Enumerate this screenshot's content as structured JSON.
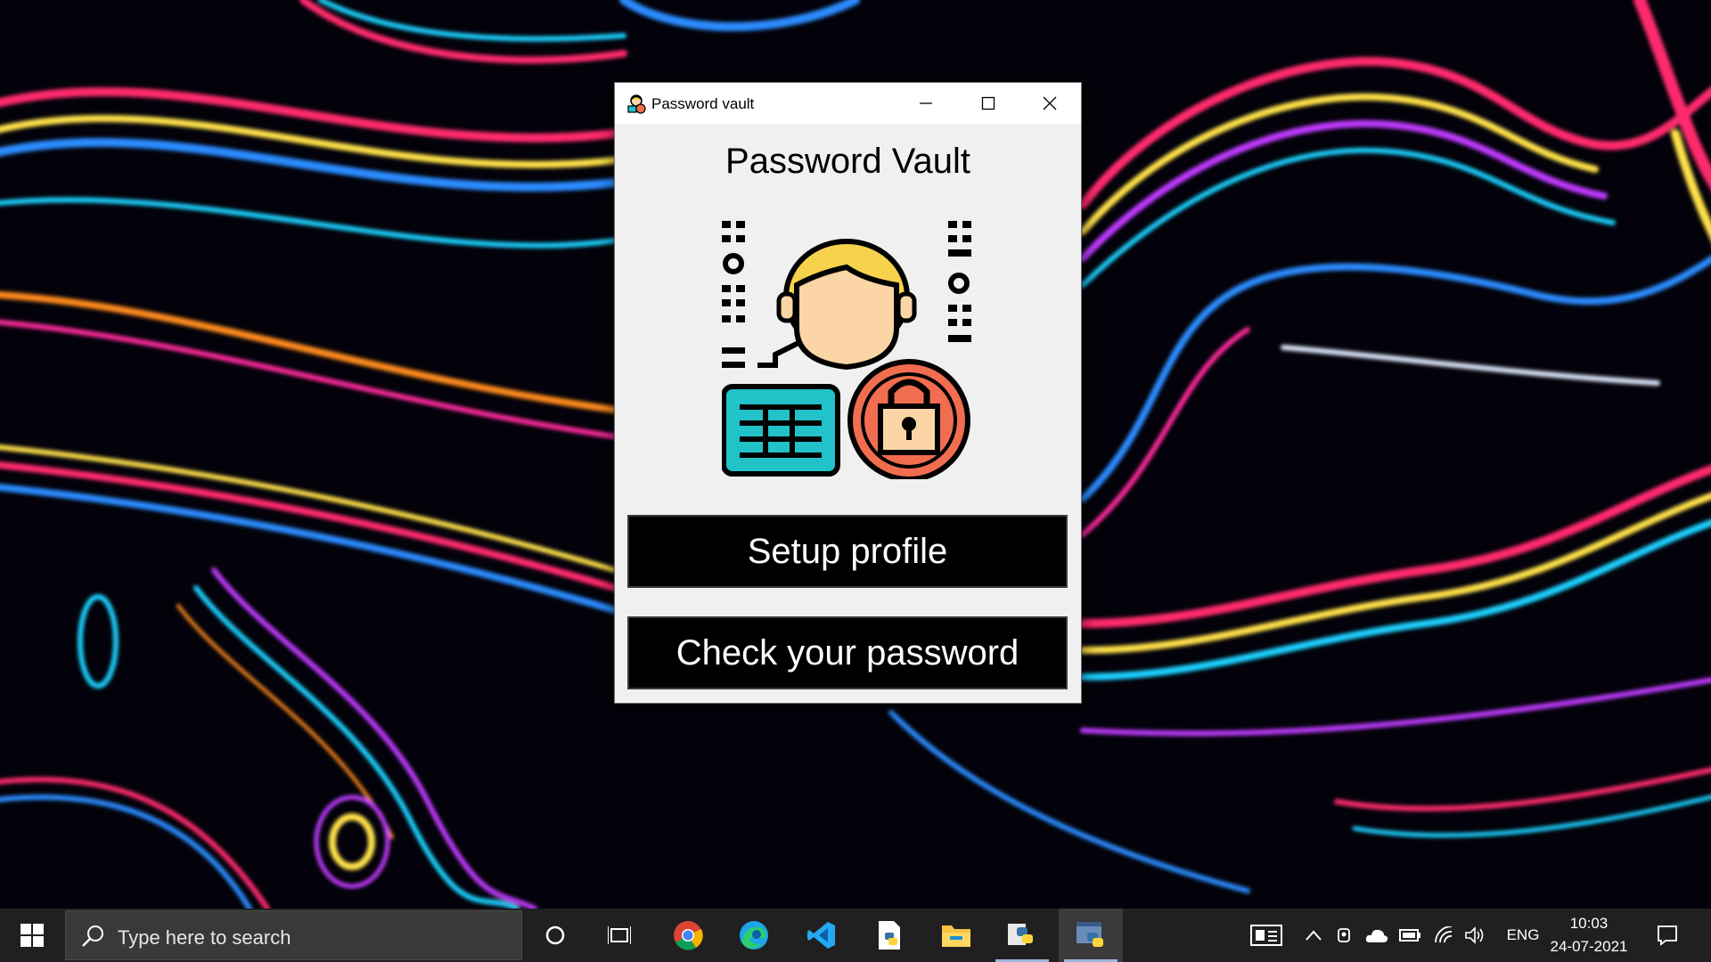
{
  "window": {
    "title": "Password vault",
    "heading": "Password Vault",
    "setup_button": "Setup profile",
    "check_button": "Check your password",
    "controls": {
      "minimize": "minimize-icon",
      "maximize": "maximize-icon",
      "close": "close-icon"
    },
    "hero_icon": "user-keyboard-lock-icon"
  },
  "taskbar": {
    "search_placeholder": "Type here to search",
    "apps": [
      {
        "icon": "cortana-icon"
      },
      {
        "icon": "task-view-icon"
      },
      {
        "icon": "chrome-icon"
      },
      {
        "icon": "edge-icon"
      },
      {
        "icon": "vscode-icon"
      },
      {
        "icon": "python-file-icon"
      },
      {
        "icon": "file-explorer-icon"
      },
      {
        "icon": "python-idle-icon"
      },
      {
        "icon": "python-app-icon"
      }
    ],
    "tray": {
      "language": "ENG",
      "time": "10:03",
      "date": "24-07-2021"
    }
  },
  "colors": {
    "accent_red": "#f16d4f",
    "accent_teal": "#21c2c8",
    "accent_yellow": "#f6d24d",
    "skin": "#fbd5a5"
  }
}
